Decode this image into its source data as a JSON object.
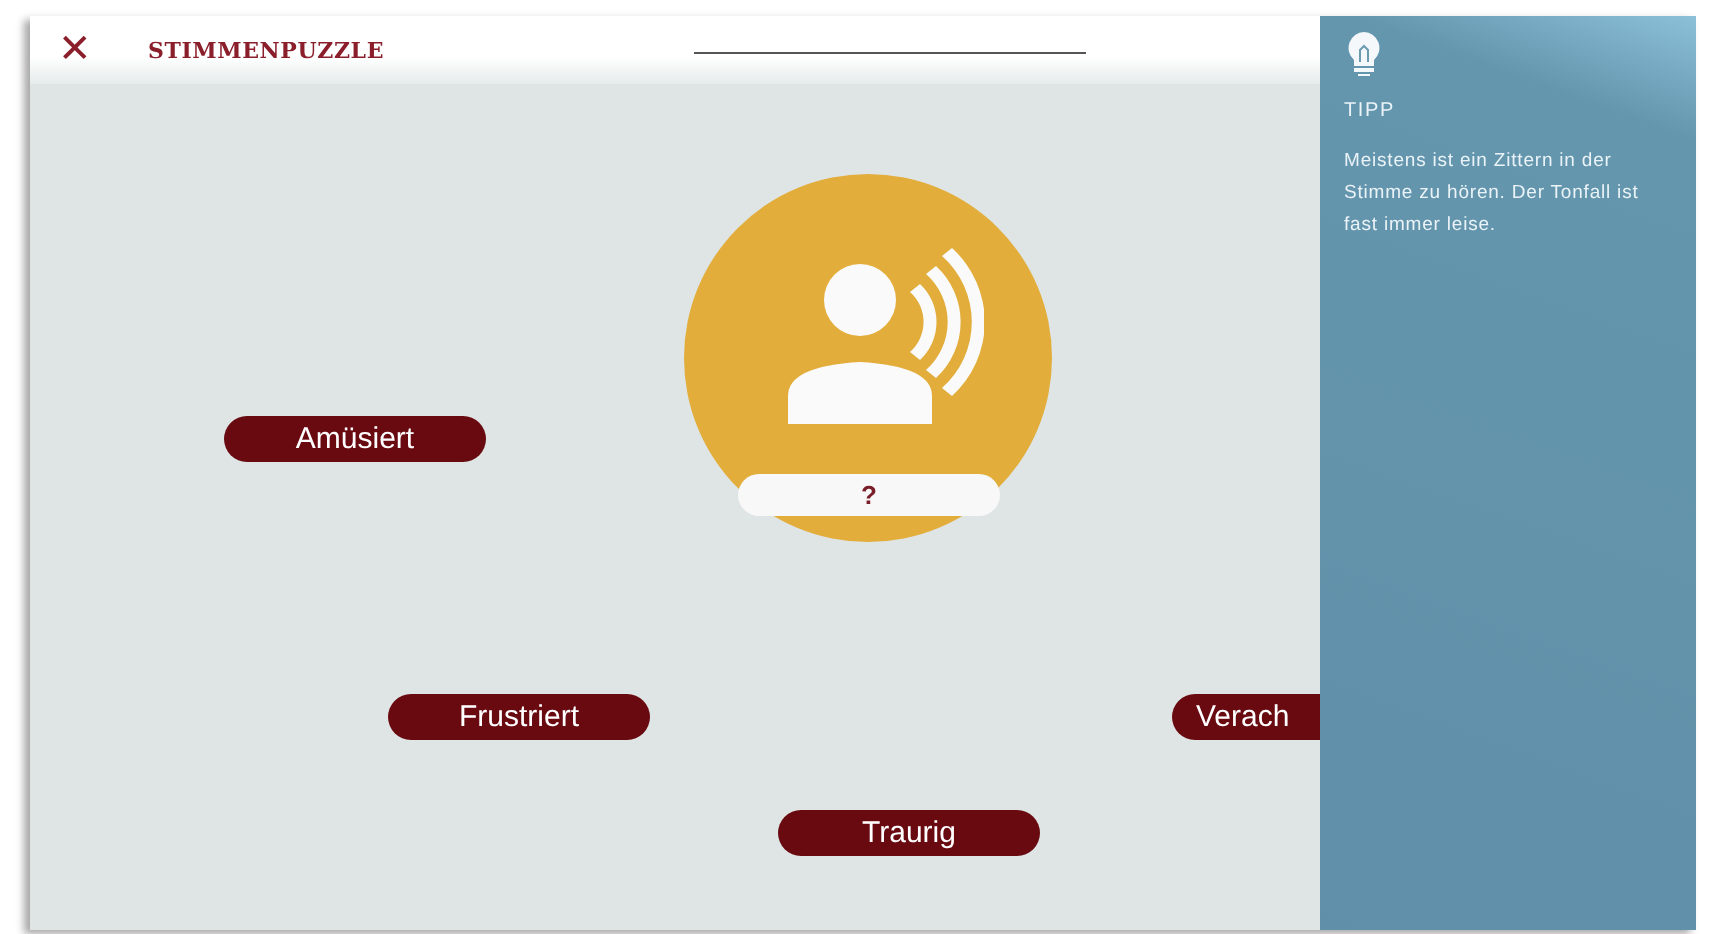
{
  "header": {
    "close_icon": "✕",
    "title": "STIMMENPUZZLE"
  },
  "speaker": {
    "answer": "?"
  },
  "options": [
    {
      "label": "Amüsiert"
    },
    {
      "label": "Frustriert"
    },
    {
      "label": "Verach"
    },
    {
      "label": "Traurig"
    }
  ],
  "tip": {
    "title": "TIPP",
    "text": "Meistens ist ein Zittern in der Stimme zu hören. Der Tonfall ist fast immer leise."
  }
}
